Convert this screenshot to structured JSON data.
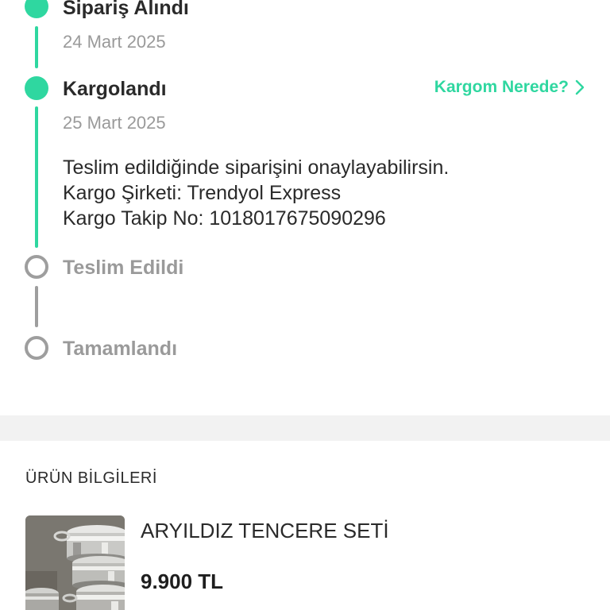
{
  "timeline": {
    "steps": [
      {
        "title": "Sipariş Alındı",
        "date": "24 Mart 2025",
        "state": "done"
      },
      {
        "title": "Kargolandı",
        "date": "25 Mart 2025",
        "state": "current",
        "link_label": "Kargom Nerede?",
        "details": [
          "Teslim edildiğinde siparişini onaylayabilirsin.",
          "Kargo Şirketi: Trendyol Express",
          "Kargo Takip No: 1018017675090296"
        ]
      },
      {
        "title": "Teslim Edildi",
        "state": "pending"
      },
      {
        "title": "Tamamlandı",
        "state": "pending"
      }
    ]
  },
  "product_section": {
    "title": "ÜRÜN BİLGİLERİ",
    "product": {
      "name": "ARYILDIZ TENCERE SETİ",
      "price": "9.900 TL",
      "image_icon": "cookware-set-photo"
    }
  },
  "colors": {
    "accent": "#2fd7a0",
    "inactive": "#9e9e9e",
    "text": "#2a2a2a",
    "band": "#f2f2f2"
  }
}
